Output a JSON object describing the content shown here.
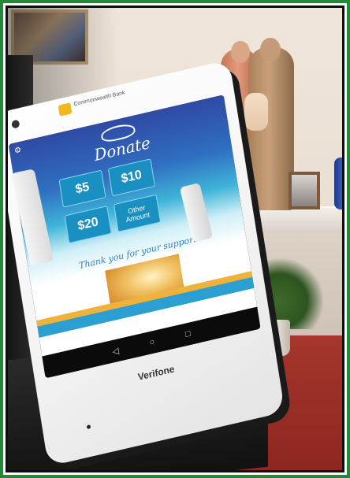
{
  "photo": {
    "device": {
      "bank_brand": "Commonwealth Bank",
      "manufacturer": "Verifone"
    },
    "app": {
      "title": "Donate",
      "amounts": [
        "$5",
        "$10",
        "$20"
      ],
      "other_label": "Other Amount",
      "thanks_text": "Thank you for your support",
      "nav_icons": [
        "back-icon",
        "home-icon",
        "recents-icon"
      ]
    },
    "colors": {
      "frame_green": "#1f8a3a",
      "app_blue": "#2f4aa5",
      "button_blue": "#1a8fc2",
      "accent_orange": "#f0b23a"
    }
  }
}
